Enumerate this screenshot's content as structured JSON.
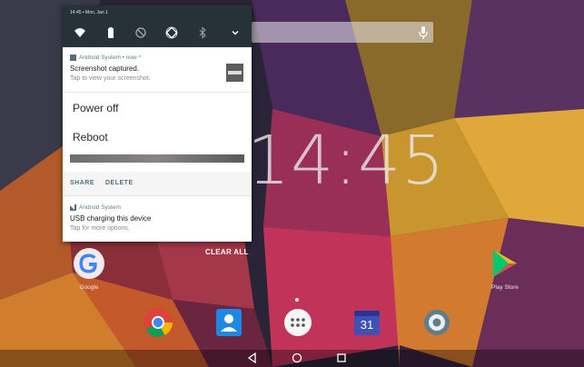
{
  "status_bar": {
    "time_date": "14:45 • Mon, Jan 1"
  },
  "quick_settings": {
    "icons": [
      "wifi-icon",
      "battery-icon",
      "do-not-disturb-icon",
      "auto-rotate-icon",
      "bluetooth-icon",
      "expand-icon"
    ]
  },
  "notification_screenshot": {
    "app": "Android System • now ^",
    "title": "Screenshot captured.",
    "subtitle": "Tap to view your screenshot."
  },
  "power_menu": {
    "power_off": "Power off",
    "reboot": "Reboot"
  },
  "actions": {
    "share": "SHARE",
    "delete": "DELETE"
  },
  "notification_usb": {
    "app": "Android System",
    "title": "USB charging this device",
    "subtitle": "Tap for more options."
  },
  "home": {
    "clock": "14:45",
    "clear_all": "CLEAR ALL",
    "apps": [
      {
        "name": "Google",
        "label": "Google"
      },
      {
        "name": "Play Store",
        "label": "Play Store"
      }
    ],
    "dock": [
      "Chrome",
      "Contacts",
      "App drawer",
      "Calendar",
      "Settings"
    ],
    "calendar_day": "31"
  },
  "colors": {
    "shade_header": "#263238",
    "accent": "#546e7a"
  }
}
